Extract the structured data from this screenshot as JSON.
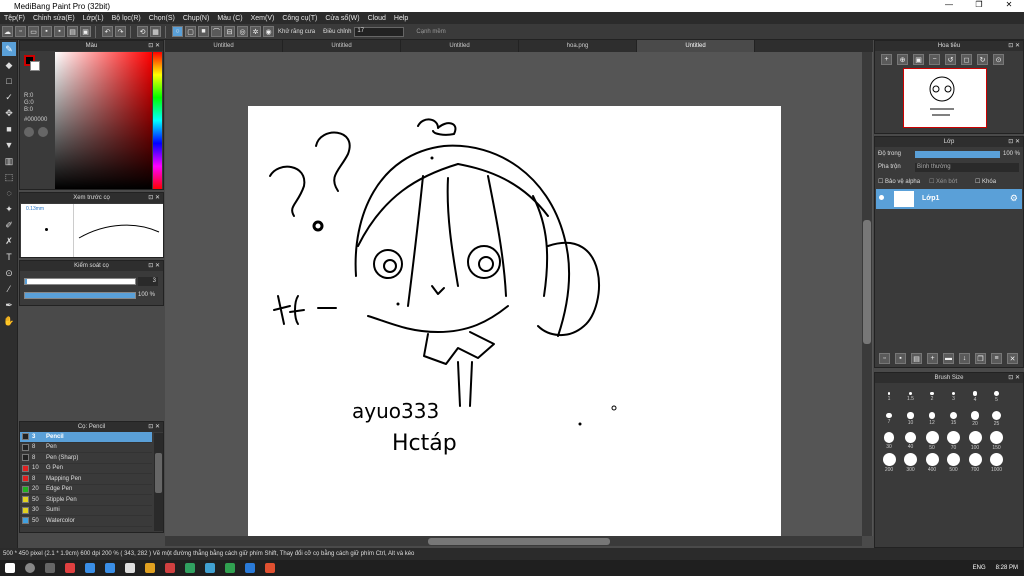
{
  "titlebar": {
    "title": "MediBang Paint Pro (32bit)",
    "min": "—",
    "max": "❐",
    "close": "✕"
  },
  "menu": [
    "Tệp(F)",
    "Chỉnh sửa(E)",
    "Lớp(L)",
    "Bộ lọc(R)",
    "Chọn(S)",
    "Chụp(N)",
    "Màu (C)",
    "Xem(V)",
    "Công cụ(T)",
    "Cửa sổ(W)",
    "Cloud",
    "Help"
  ],
  "toolbar": {
    "antialias_label": "Khử răng cưa",
    "adjust_label": "Điều chỉnh",
    "adjust_value": "17",
    "edge_label": "Cạnh mềm"
  },
  "tabs": [
    "Untitled",
    "Untitled",
    "Untitled",
    "hoa.png",
    "Untitled"
  ],
  "color_panel": {
    "title": "Màu",
    "rgb_r": "R:0",
    "rgb_g": "G:0",
    "rgb_b": "B:0",
    "hex": "#000000"
  },
  "preview_panel": {
    "title": "Xem trước cọ",
    "size": "0.13mm"
  },
  "control_panel": {
    "title": "Kiểm soát cọ",
    "size_value": "3",
    "opacity_value": "100 %"
  },
  "brush_panel": {
    "title": "Cọ: Pencil",
    "items": [
      {
        "size": "3",
        "name": "Pencil",
        "color": "#222222"
      },
      {
        "size": "8",
        "name": "Pen",
        "color": "#222222"
      },
      {
        "size": "8",
        "name": "Pen (Sharp)",
        "color": "#222222"
      },
      {
        "size": "10",
        "name": "G Pen",
        "color": "#e02020"
      },
      {
        "size": "8",
        "name": "Mapping Pen",
        "color": "#e02020"
      },
      {
        "size": "20",
        "name": "Edge Pen",
        "color": "#20b020"
      },
      {
        "size": "50",
        "name": "Stipple Pen",
        "color": "#e0d020"
      },
      {
        "size": "30",
        "name": "Sumi",
        "color": "#e0d020"
      },
      {
        "size": "50",
        "name": "Watercolor",
        "color": "#40a0e0"
      }
    ]
  },
  "navigator": {
    "title": "Hoa tiêu"
  },
  "layer_panel": {
    "title": "Lớp",
    "opacity_label": "Độ trong",
    "opacity_value": "100 %",
    "blend_label": "Pha trộn",
    "blend_value": "Bình thường",
    "protect_alpha": "Bảo vệ alpha",
    "clipping": "Xén bớt",
    "lock": "Khóa",
    "layer_name": "Lớp1"
  },
  "brush_size": {
    "title": "Brush Size",
    "sizes": [
      "1",
      "1.5",
      "2",
      "3",
      "4",
      "5",
      "7",
      "10",
      "12",
      "15",
      "20",
      "25",
      "30",
      "40",
      "50",
      "70",
      "100",
      "150",
      "200",
      "300",
      "400",
      "500",
      "700",
      "1000"
    ]
  },
  "status": {
    "text": "500 * 450 pixel   (2.1 * 1.9cm)   600 dpi   200 %   ( 343, 282 )   Vẽ một đường thẳng bằng cách giữ phím Shift, Thay đổi cỡ cọ bằng cách giữ phím Ctrl, Alt và kéo"
  },
  "taskbar": {
    "lang": "ENG",
    "time": "8:28 PM"
  },
  "canvas_text": {
    "line1": "ayuo333",
    "line2": "Hctáp",
    "side": "tf -"
  }
}
